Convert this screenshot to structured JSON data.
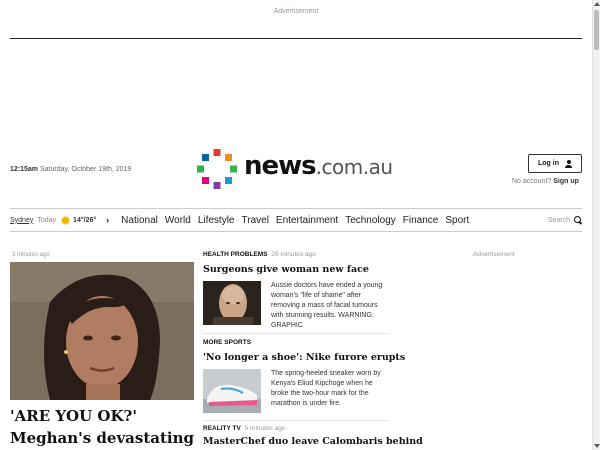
{
  "ads": {
    "top_label": "Advertisement",
    "side_label": "Advertisement"
  },
  "header": {
    "time": "12:15am",
    "date": "Saturday, October 19th, 2019",
    "logo": {
      "main": "news",
      "suffix": ".com.au"
    },
    "login_label": "Log in",
    "no_account_text": "No account?",
    "signup_label": "Sign up"
  },
  "nav": {
    "city": "Sydney",
    "today": "Today",
    "temps": "14°/26°",
    "links": [
      "National",
      "World",
      "Lifestyle",
      "Travel",
      "Entertainment",
      "Technology",
      "Finance",
      "Sport"
    ],
    "search_label": "Search"
  },
  "lead": {
    "time": "3 minutes ago",
    "headline": "'ARE YOU OK?' Meghan's devastating answer to"
  },
  "stories": [
    {
      "kicker": "HEALTH PROBLEMS",
      "time": "26 minutes ago",
      "title": "Surgeons give woman new face",
      "blurb": "Aussie doctors have ended a young woman's \"life of shame\" after removing a mass of facial tumours with stunning results. WARNING: GRAPHIC"
    },
    {
      "kicker": "MORE SPORTS",
      "time": "",
      "title": "'No longer a shoe': Nike furore erupts",
      "blurb": "The spring-heeled sneaker worn by Kenya's Eliud Kipchoge when he broke the two-hour mark for the marathon is under fire."
    },
    {
      "kicker": "REALITY TV",
      "time": "5 minutes ago",
      "title": "MasterChef duo leave Calombaris behind",
      "blurb": ""
    }
  ],
  "colors": {
    "logo_dots": [
      "#e8392e",
      "#f28c1e",
      "#37b14a",
      "#1d9ad6",
      "#7b3fa0",
      "#e6007e",
      "#2db34a",
      "#0b5fa5"
    ]
  }
}
